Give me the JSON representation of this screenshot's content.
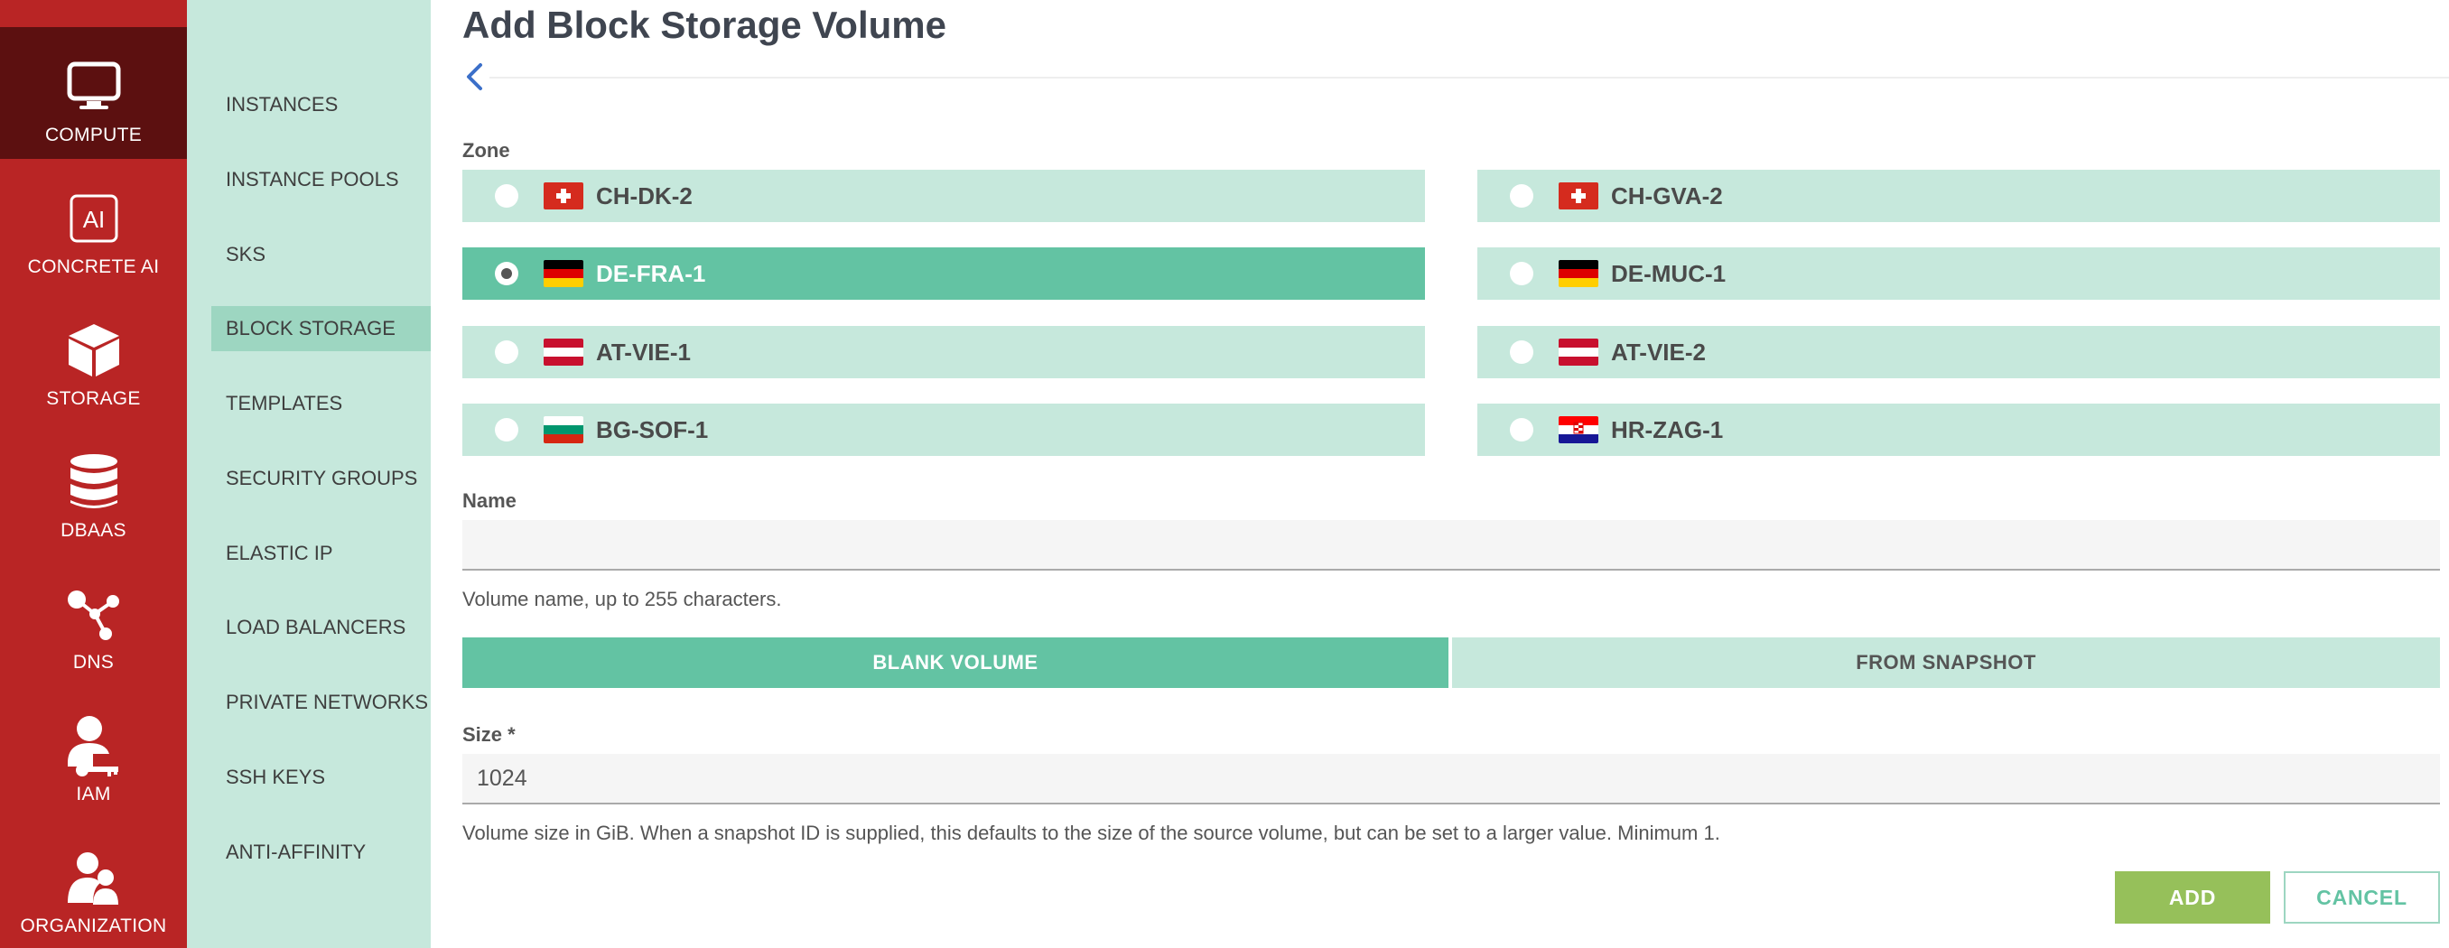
{
  "rail": [
    {
      "label": "COMPUTE",
      "icon": "monitor-icon",
      "active": true
    },
    {
      "label": "CONCRETE AI",
      "icon": "ai-icon"
    },
    {
      "label": "STORAGE",
      "icon": "cube-icon"
    },
    {
      "label": "DBAAS",
      "icon": "database-icon"
    },
    {
      "label": "DNS",
      "icon": "network-icon"
    },
    {
      "label": "IAM",
      "icon": "user-key-icon"
    },
    {
      "label": "ORGANIZATION",
      "icon": "users-icon"
    }
  ],
  "submenu": [
    {
      "label": "INSTANCES"
    },
    {
      "label": "INSTANCE POOLS"
    },
    {
      "label": "SKS"
    },
    {
      "label": "BLOCK STORAGE",
      "active": true
    },
    {
      "label": "TEMPLATES"
    },
    {
      "label": "SECURITY GROUPS"
    },
    {
      "label": "ELASTIC IP"
    },
    {
      "label": "LOAD BALANCERS"
    },
    {
      "label": "PRIVATE NETWORKS"
    },
    {
      "label": "SSH KEYS"
    },
    {
      "label": "ANTI-AFFINITY"
    }
  ],
  "page": {
    "title": "Add Block Storage Volume",
    "zone_label": "Zone",
    "zones": [
      {
        "name": "CH-DK-2",
        "flag": "switzerland-flag-icon",
        "selected": false
      },
      {
        "name": "CH-GVA-2",
        "flag": "switzerland-flag-icon",
        "selected": false
      },
      {
        "name": "DE-FRA-1",
        "flag": "germany-flag-icon",
        "selected": true
      },
      {
        "name": "DE-MUC-1",
        "flag": "germany-flag-icon",
        "selected": false
      },
      {
        "name": "AT-VIE-1",
        "flag": "austria-flag-icon",
        "selected": false
      },
      {
        "name": "AT-VIE-2",
        "flag": "austria-flag-icon",
        "selected": false
      },
      {
        "name": "BG-SOF-1",
        "flag": "bulgaria-flag-icon",
        "selected": false
      },
      {
        "name": "HR-ZAG-1",
        "flag": "croatia-flag-icon",
        "selected": false
      }
    ],
    "name_label": "Name",
    "name_value": "",
    "name_help": "Volume name, up to 255 characters.",
    "source_tabs": [
      {
        "label": "BLANK VOLUME",
        "active": true
      },
      {
        "label": "FROM SNAPSHOT",
        "active": false
      }
    ],
    "size_label": "Size *",
    "size_value": "1024",
    "size_help": "Volume size in GiB. When a snapshot ID is supplied, this defaults to the size of the source volume, but can be set to a larger value. Minimum 1.",
    "add_label": "ADD",
    "cancel_label": "CANCEL"
  },
  "colors": {
    "rail": "#b92525",
    "rail_active": "#5c1010",
    "submenu": "#c6e8dc",
    "submenu_active": "#9dd6c1",
    "accent": "#63c3a3",
    "add_button": "#96c05a"
  }
}
